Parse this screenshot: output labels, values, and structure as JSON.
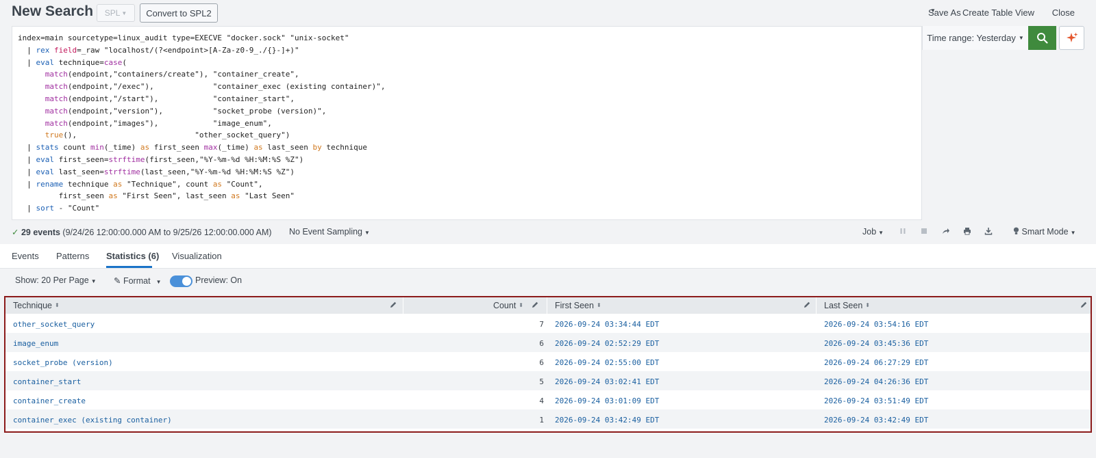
{
  "header": {
    "title": "New Search",
    "lang_label": "SPL",
    "convert_label": "Convert to SPL2",
    "save_as": "Save As",
    "create_table_view": "Create Table View",
    "close": "Close"
  },
  "query": {
    "line1": "index=main sourcetype=linux_audit type=EXECVE \"docker.sock\" \"unix-socket\"",
    "line2_pipe": "  | ",
    "line2_cmd": "rex",
    "line2_sp": " ",
    "line2_field": "field",
    "line2_rest": "=_raw \"localhost/(?<endpoint>[A-Za-z0-9_./{}-]+)\"",
    "line3_pipe": "  | ",
    "line3_cmd": "eval",
    "line3_mid": " technique=",
    "line3_fn": "case",
    "line3_rest": "(",
    "case_rows": [
      {
        "fn": "match",
        "args": "(endpoint,\"containers/create\"), ",
        "val": "\"container_create\","
      },
      {
        "fn": "match",
        "args": "(endpoint,\"/exec\"),             ",
        "val": "\"container_exec (existing container)\","
      },
      {
        "fn": "match",
        "args": "(endpoint,\"/start\"),            ",
        "val": "\"container_start\","
      },
      {
        "fn": "match",
        "args": "(endpoint,\"version\"),           ",
        "val": "\"socket_probe (version)\","
      },
      {
        "fn": "match",
        "args": "(endpoint,\"images\"),            ",
        "val": "\"image_enum\","
      },
      {
        "fn": "true",
        "args": "(),                          ",
        "val": "\"other_socket_query\")"
      }
    ],
    "stats_cmd": "stats",
    "stats_a": " count ",
    "stats_min": "min",
    "stats_b": "(_time) ",
    "stats_as1": "as",
    "stats_c": " first_seen ",
    "stats_max": "max",
    "stats_d": "(_time) ",
    "stats_as2": "as",
    "stats_e": " last_seen ",
    "stats_by": "by",
    "stats_f": " technique",
    "eval1_cmd": "eval",
    "eval1_a": " first_seen=",
    "eval1_fn": "strftime",
    "eval1_b": "(first_seen,\"%Y-%m-%d %H:%M:%S %Z\")",
    "eval2_cmd": "eval",
    "eval2_a": " last_seen=",
    "eval2_fn": "strftime",
    "eval2_b": "(last_seen,\"%Y-%m-%d %H:%M:%S %Z\")",
    "rename_cmd": "rename",
    "rename_a": " technique ",
    "rename_as1": "as",
    "rename_b": " \"Technique\", count ",
    "rename_as2": "as",
    "rename_c": " \"Count\",",
    "rename2_a": "         first_seen ",
    "rename2_as1": "as",
    "rename2_b": " \"First Seen\", last_seen ",
    "rename2_as2": "as",
    "rename2_c": " \"Last Seen\"",
    "sort_cmd": "sort",
    "sort_rest": " - \"Count\""
  },
  "time_range": "Time range: Yesterday",
  "status": {
    "events_count": "29 events",
    "events_range": " (9/24/26 12:00:00.000 AM to 9/25/26 12:00:00.000 AM)",
    "sampling": "No Event Sampling",
    "job": "Job",
    "mode": "Smart Mode"
  },
  "tabs": [
    {
      "label": "Events"
    },
    {
      "label": "Patterns"
    },
    {
      "label": "Statistics (6)"
    },
    {
      "label": "Visualization"
    }
  ],
  "controls": {
    "show": "Show: 20 Per Page",
    "format": "Format",
    "preview": "Preview: On"
  },
  "table": {
    "columns": [
      "Technique",
      "Count",
      "First Seen",
      "Last Seen"
    ],
    "rows": [
      {
        "technique": "other_socket_query",
        "count": "7",
        "first": "2026-09-24 03:34:44 EDT",
        "last": "2026-09-24 03:54:16 EDT"
      },
      {
        "technique": "image_enum",
        "count": "6",
        "first": "2026-09-24 02:52:29 EDT",
        "last": "2026-09-24 03:45:36 EDT"
      },
      {
        "technique": "socket_probe (version)",
        "count": "6",
        "first": "2026-09-24 02:55:00 EDT",
        "last": "2026-09-24 06:27:29 EDT"
      },
      {
        "technique": "container_start",
        "count": "5",
        "first": "2026-09-24 03:02:41 EDT",
        "last": "2026-09-24 04:26:36 EDT"
      },
      {
        "technique": "container_create",
        "count": "4",
        "first": "2026-09-24 03:01:09 EDT",
        "last": "2026-09-24 03:51:49 EDT"
      },
      {
        "technique": "container_exec (existing container)",
        "count": "1",
        "first": "2026-09-24 03:42:49 EDT",
        "last": "2026-09-24 03:42:49 EDT"
      }
    ]
  },
  "colors": {
    "search_green": "#3f8a3d",
    "tab_accent": "#1a73c8",
    "highlight_border": "#8b1a1a",
    "link_blue": "#1a5fa0"
  }
}
